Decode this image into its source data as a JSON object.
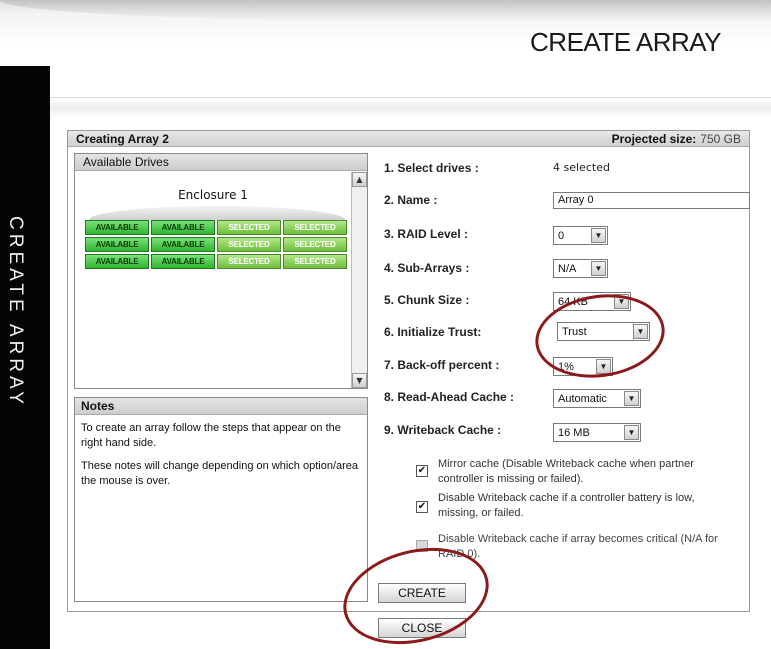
{
  "header": {
    "title": "CREATE ARRAY"
  },
  "sidebar": {
    "title": "CREATE ARRAY"
  },
  "panel": {
    "title": "Creating Array 2",
    "projected_label": "Projected size:",
    "projected_value": "750 GB"
  },
  "drives": {
    "heading": "Available Drives",
    "enclosure": "Enclosure 1",
    "rows": [
      [
        "AVAILABLE",
        "AVAILABLE",
        "SELECTED",
        "SELECTED"
      ],
      [
        "AVAILABLE",
        "AVAILABLE",
        "SELECTED",
        "SELECTED"
      ],
      [
        "AVAILABLE",
        "AVAILABLE",
        "SELECTED",
        "SELECTED"
      ]
    ]
  },
  "notes": {
    "heading": "Notes",
    "p1": "To create an array follow the steps that appear on the right hand side.",
    "p2": "These notes will change depending on which option/area the mouse is over."
  },
  "steps": {
    "s1": {
      "label": "1. Select drives :",
      "value": "4 selected"
    },
    "s2": {
      "label": "2. Name :",
      "value": "Array 0"
    },
    "s3": {
      "label": "3. RAID Level :",
      "value": "0"
    },
    "s4": {
      "label": "4. Sub-Arrays :",
      "value": "N/A"
    },
    "s5": {
      "label": "5. Chunk Size :",
      "value": "64 KB"
    },
    "s6": {
      "label": "6. Initialize Trust:",
      "value": "Trust"
    },
    "s7": {
      "label": "7. Back-off percent :",
      "value": "1%"
    },
    "s8": {
      "label": "8. Read-Ahead Cache :",
      "value": "Automatic"
    },
    "s9": {
      "label": "9. Writeback Cache :",
      "value": "16 MB"
    }
  },
  "checkboxes": {
    "mirror": {
      "checked": true,
      "text": "Mirror cache (Disable Writeback cache when partner controller is missing or failed)."
    },
    "battery": {
      "checked": true,
      "text": "Disable Writeback cache if a controller battery is low, missing, or failed."
    },
    "critical": {
      "checked": false,
      "disabled": true,
      "text": "Disable Writeback cache if array becomes critical (N/A for RAID 0)."
    }
  },
  "buttons": {
    "create": "CREATE",
    "close": "CLOSE"
  },
  "colors": {
    "annotation": "#8b1a1a",
    "drive_available": "#2fb52f",
    "drive_selected": "#6fbf3c",
    "sidebar": "#050505"
  }
}
